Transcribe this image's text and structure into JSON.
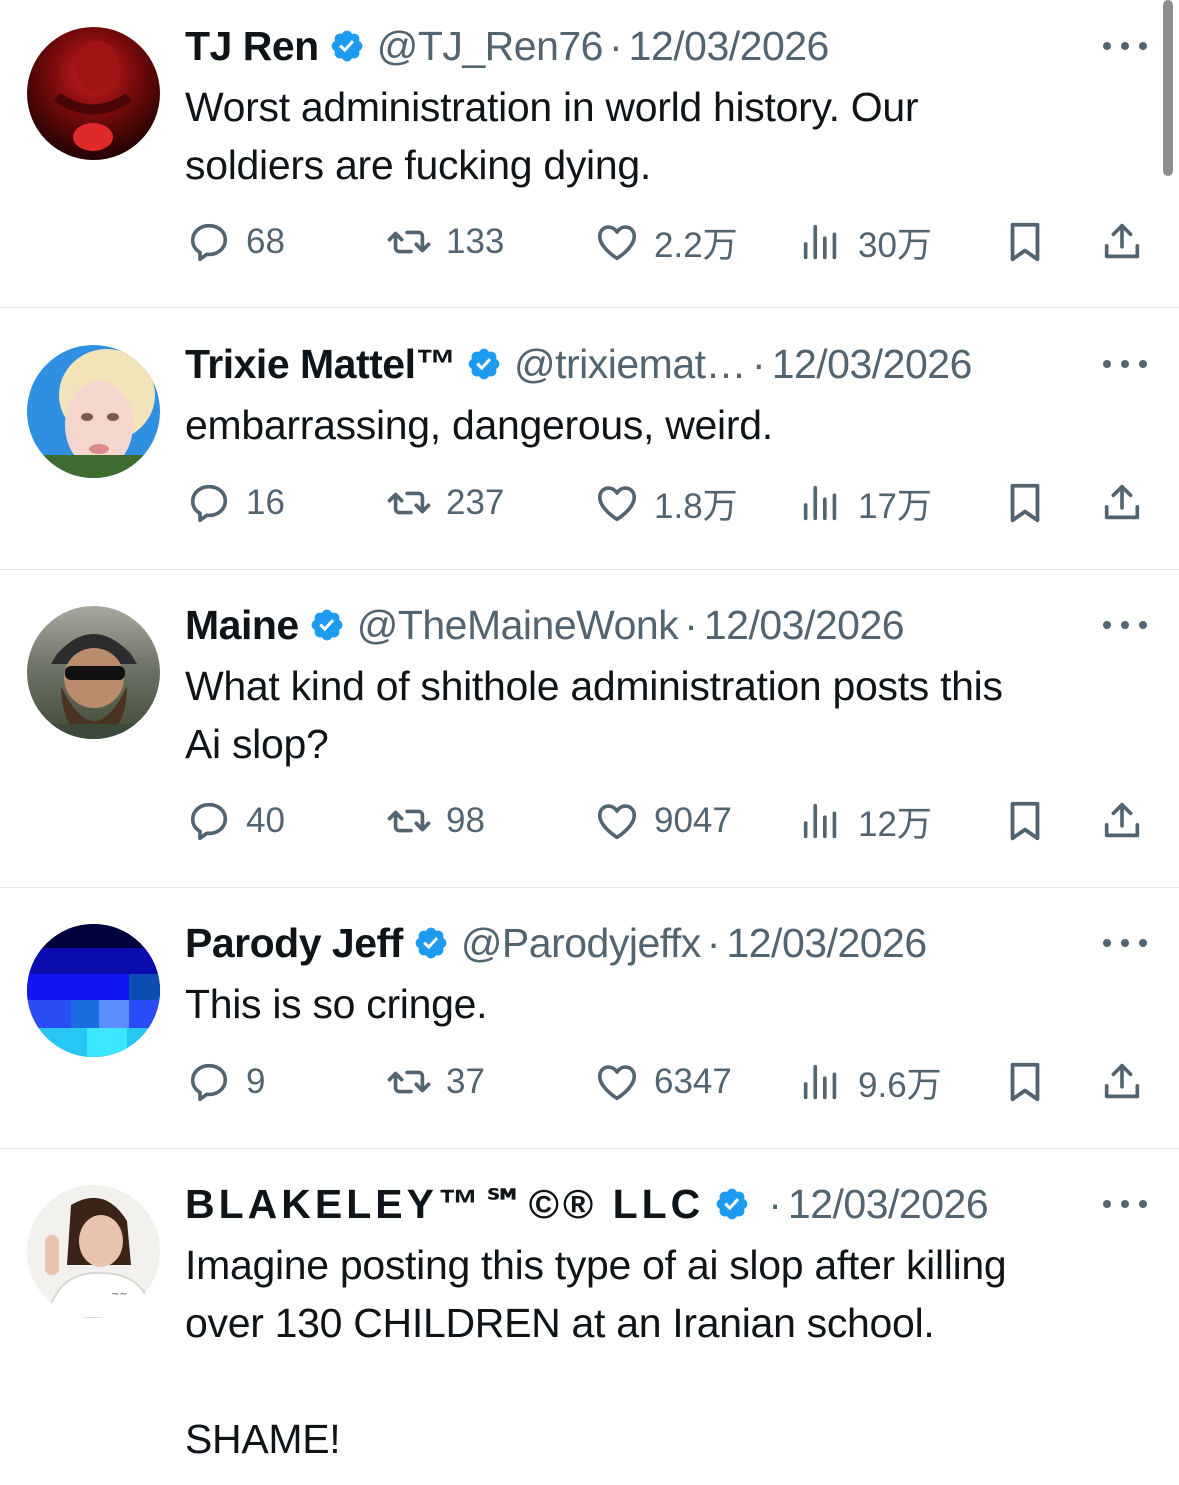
{
  "colors": {
    "text": "#0f1419",
    "secondary": "#536471",
    "verified": "#1d9bf0",
    "divider": "#e6e9ec"
  },
  "icons": {
    "verified": "verified-badge-icon",
    "more": "more-options-icon",
    "reply": "reply-icon",
    "repost": "repost-icon",
    "like": "like-icon",
    "views": "views-icon",
    "bookmark": "bookmark-icon",
    "share": "share-icon"
  },
  "tweets": [
    {
      "name": "TJ Ren",
      "handle": "@TJ_Ren76",
      "separator": "·",
      "date": "12/03/2026",
      "text": "Worst administration in world history. Our\nsoldiers are fucking dying.",
      "replies": "68",
      "reposts": "133",
      "likes": "2.2万",
      "views": "30万"
    },
    {
      "name": "Trixie Mattel™",
      "handle": "@trixiemat…",
      "separator": "·",
      "date": "12/03/2026",
      "text": "embarrassing, dangerous, weird.",
      "replies": "16",
      "reposts": "237",
      "likes": "1.8万",
      "views": "17万"
    },
    {
      "name": "Maine",
      "handle": "@TheMaineWonk",
      "separator": "·",
      "date": "12/03/2026",
      "text": "What kind of shithole administration posts this\nAi slop?",
      "replies": "40",
      "reposts": "98",
      "likes": "9047",
      "views": "12万"
    },
    {
      "name": "Parody Jeff",
      "handle": "@Parodyjeffx",
      "separator": "·",
      "date": "12/03/2026",
      "text": "This is so cringe.",
      "replies": "9",
      "reposts": "37",
      "likes": "6347",
      "views": "9.6万"
    },
    {
      "name": "BLAKELEY™℠©® LLC",
      "handle": "",
      "separator": "·",
      "date": "12/03/2026",
      "text": "Imagine posting this type of ai slop after killing\nover 130 CHILDREN at an Iranian school.\n\nSHAME!"
    }
  ]
}
